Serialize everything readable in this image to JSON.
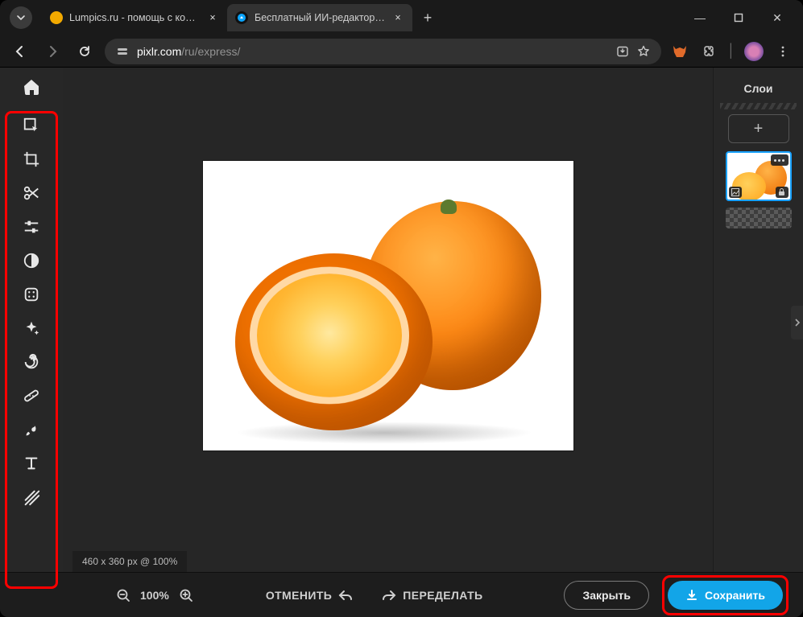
{
  "window": {
    "minimize": "—",
    "maximize": "▢",
    "close": "✕"
  },
  "tabs": {
    "t0": {
      "title": "Lumpics.ru - помощь с компь"
    },
    "t1": {
      "title": "Бесплатный ИИ-редактор фот"
    },
    "plus": "+"
  },
  "address": {
    "host": "pixlr.com",
    "path": "/ru/express/"
  },
  "tools": [
    "select",
    "crop",
    "cut",
    "adjust",
    "contrast",
    "detail",
    "sparkle",
    "spiral",
    "heal",
    "brush",
    "text",
    "draw-pattern"
  ],
  "canvas": {
    "dims": "460 x 360 px @ 100%"
  },
  "right": {
    "title": "Слои",
    "add": "+"
  },
  "footer": {
    "zoom_minus": "−",
    "zoom_value": "100%",
    "zoom_plus": "+",
    "undo": "ОТМЕНИТЬ",
    "redo": "ПЕРЕДЕЛАТЬ",
    "close": "Закрыть",
    "save": "Сохранить"
  }
}
